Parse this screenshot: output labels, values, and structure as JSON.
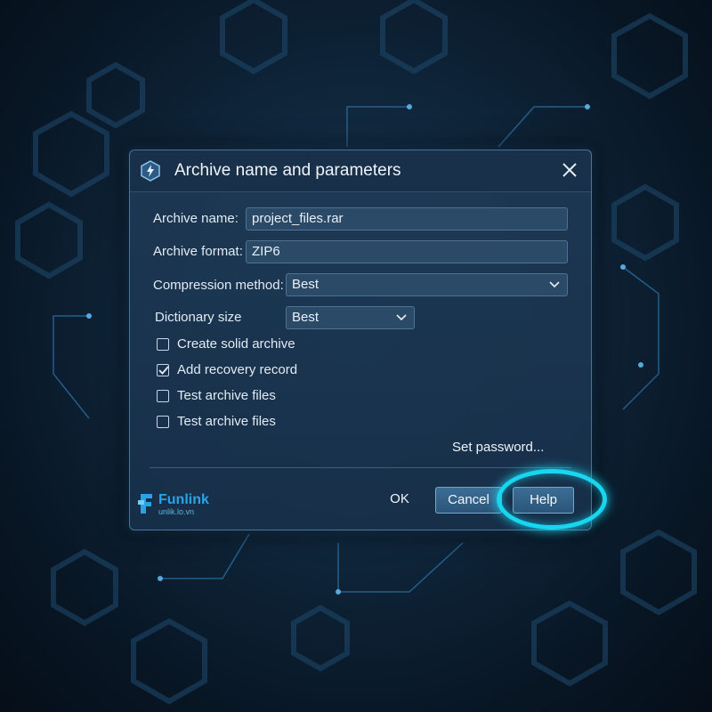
{
  "dialog": {
    "title": "Archive name and parameters",
    "app_icon": "lightning-icon",
    "close_icon": "close-icon"
  },
  "fields": {
    "archive_name_label": "Archive name:",
    "archive_name_value": "project_files.rar",
    "archive_format_label": "Archive format:",
    "archive_format_value": "ZIP6",
    "compression_label": "Compression method:",
    "compression_value": "Best",
    "dictionary_label": "Dictionary size",
    "dictionary_value": "Best"
  },
  "options": [
    {
      "label": "Create solid archive",
      "checked": false
    },
    {
      "label": "Add recovery record",
      "checked": true
    },
    {
      "label": "Test archive files",
      "checked": false
    },
    {
      "label": "Test archive files",
      "checked": false
    }
  ],
  "set_password_label": "Set password...",
  "buttons": {
    "ok": "OK",
    "cancel": "Cancel",
    "help": "Help"
  },
  "watermark": {
    "brand": "Funlink",
    "url": "unlik.lo.vn"
  },
  "colors": {
    "accent_ring": "#19d6f0",
    "dialog_bg": "#1e3a56",
    "button_bg": "#3c6d96"
  }
}
